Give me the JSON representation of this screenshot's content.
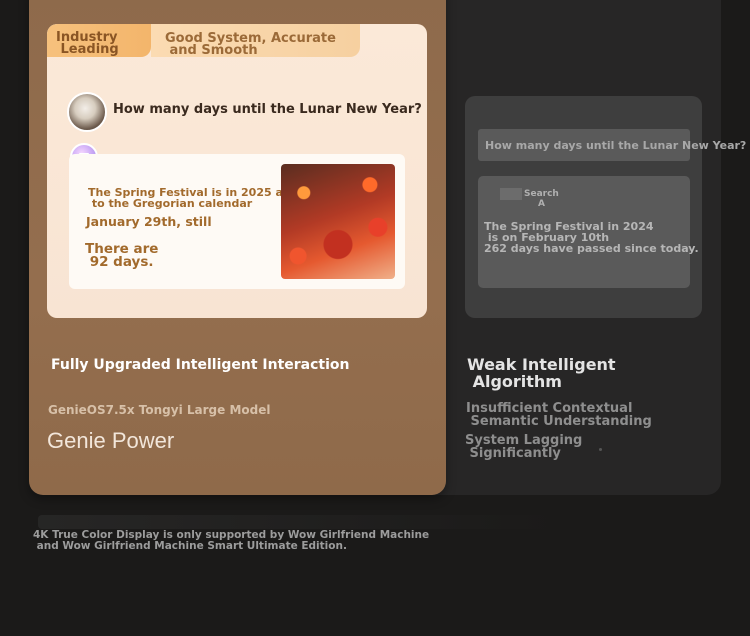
{
  "left_panel": {
    "tab_industry": "Industry\n Leading",
    "tab_good": "Good System, Accurate\n and Smooth",
    "question": "How many days until the Lunar New Year?",
    "answer_line1": "The Spring Festival is in 2025 according\n to the Gregorian calendar",
    "answer_line2": "January 29th, still",
    "answer_line3": "There are\n 92 days.",
    "title": "Fully Upgraded Intelligent Interaction",
    "subtitle": "GenieOS7.5x Tongyi Large Model",
    "brand": "Genie Power"
  },
  "right_panel": {
    "question": "How many days until the Lunar New Year?",
    "search_label": "Search\nA",
    "answer": "The Spring Festival in 2024\n is on February 10th\n262 days have passed since today.",
    "title": "Weak Intelligent\n Algorithm",
    "point1": "Insufficient Contextual\n Semantic Understanding",
    "point2": "System Lagging\n Significantly"
  },
  "footnote": "4K True Color Display is only supported by Wow Girlfriend Machine\n and Wow Girlfriend Machine Smart Ultimate Edition."
}
